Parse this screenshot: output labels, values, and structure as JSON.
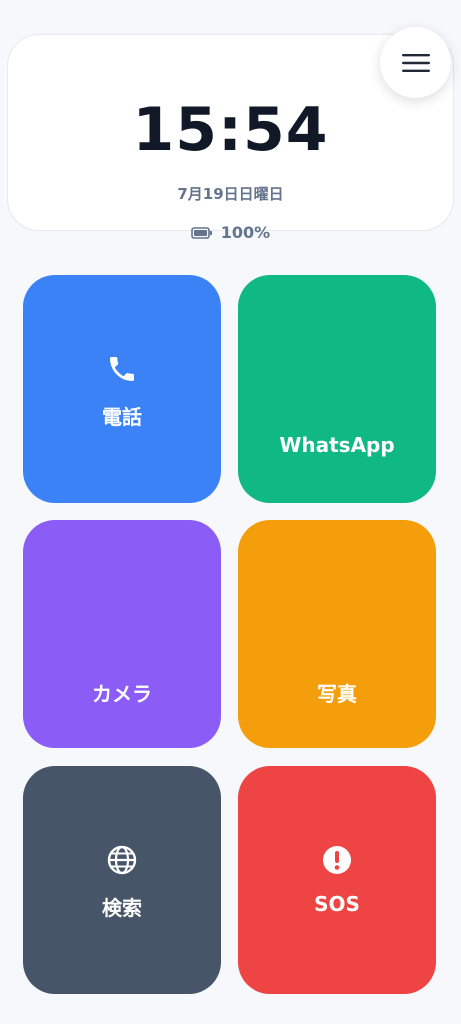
{
  "status": {
    "time": "15:54",
    "date": "7月19日日曜日",
    "battery": "100%"
  },
  "menu": {
    "icon": "hamburger-menu-icon"
  },
  "tiles": [
    {
      "label": "電話",
      "color": "#3b82f6",
      "icon": "phone-icon"
    },
    {
      "label": "WhatsApp",
      "color": "#10b981"
    },
    {
      "label": "カメラ",
      "color": "#8b5cf6"
    },
    {
      "label": "写真",
      "color": "#f59e0b"
    },
    {
      "label": "検索",
      "color": "#475569",
      "icon": "globe-icon"
    },
    {
      "label": "SOS",
      "color": "#ef4444",
      "icon": "alert-icon"
    }
  ]
}
